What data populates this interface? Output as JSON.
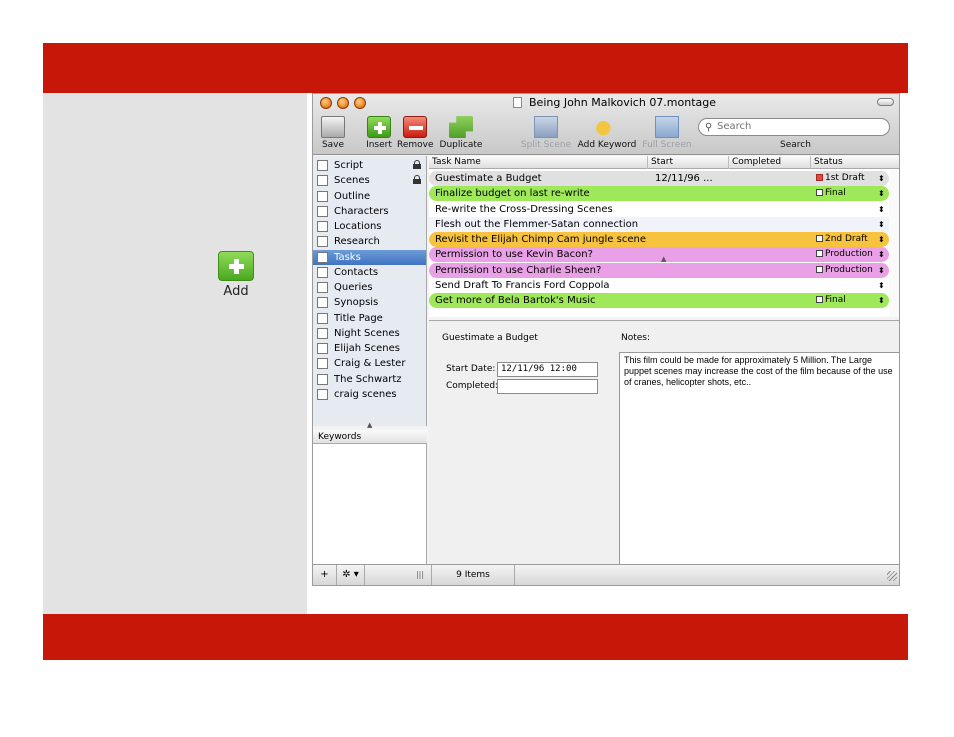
{
  "slide": {
    "add_label": "Add",
    "colors": {
      "band": "#c61708",
      "panel": "#e3e3e3"
    }
  },
  "window": {
    "title": "Being John Malkovich 07.montage",
    "toolbar": {
      "save": "Save",
      "insert": "Insert",
      "remove": "Remove",
      "duplicate": "Duplicate",
      "split_scene": "Split Scene",
      "add_keyword": "Add Keyword",
      "full_screen": "Full Screen",
      "search_label": "Search",
      "search_placeholder": "Search"
    },
    "sidebar": {
      "items": [
        {
          "label": "Script",
          "icon": "script-icon",
          "locked": true
        },
        {
          "label": "Scenes",
          "icon": "scenes-icon",
          "locked": true
        },
        {
          "label": "Outline",
          "icon": "outline-icon"
        },
        {
          "label": "Characters",
          "icon": "characters-icon"
        },
        {
          "label": "Locations",
          "icon": "locations-icon"
        },
        {
          "label": "Research",
          "icon": "research-icon"
        },
        {
          "label": "Tasks",
          "icon": "tasks-icon",
          "selected": true
        },
        {
          "label": "Contacts",
          "icon": "contacts-icon"
        },
        {
          "label": "Queries",
          "icon": "queries-icon"
        },
        {
          "label": "Synopsis",
          "icon": "synopsis-icon"
        },
        {
          "label": "Title Page",
          "icon": "title-page-icon"
        },
        {
          "label": "Night Scenes",
          "icon": "smart-folder-icon"
        },
        {
          "label": "Elijah Scenes",
          "icon": "smart-folder-icon"
        },
        {
          "label": "Craig & Lester",
          "icon": "smart-folder-icon"
        },
        {
          "label": "The Schwartz",
          "icon": "smart-folder-icon"
        },
        {
          "label": "craig scenes",
          "icon": "smart-folder-icon"
        }
      ]
    },
    "keywords_header": "Keywords",
    "bottom_bar": {
      "add": "+",
      "action": "✲ ▾",
      "item_count": "9 Items"
    },
    "table": {
      "columns": {
        "name": "Task Name",
        "start": "Start",
        "completed": "Completed",
        "status": "Status"
      },
      "rows": [
        {
          "name": "Guestimate a Budget",
          "start": "12/11/96 ...",
          "status": "1st Draft",
          "color": "#e0e0e0",
          "status_box": "red"
        },
        {
          "name": "Finalize budget on last re-write",
          "start": "",
          "status": "Final",
          "color": "#9ee85a"
        },
        {
          "name": "Re-write the Cross-Dressing Scenes",
          "start": "",
          "status": "",
          "color": ""
        },
        {
          "name": "Flesh out the Flemmer-Satan connection",
          "start": "",
          "status": "",
          "color": "#f0f4fa"
        },
        {
          "name": "Revisit the Elijah Chimp Cam jungle scene",
          "start": "",
          "status": "2nd Draft",
          "color": "#f7c23e"
        },
        {
          "name": "Permission to use Kevin Bacon?",
          "start": "",
          "status": "Production",
          "color": "#eaa0e6"
        },
        {
          "name": "Permission to use Charlie Sheen?",
          "start": "",
          "status": "Production",
          "color": "#eaa0e6"
        },
        {
          "name": "Send Draft To Francis Ford Coppola",
          "start": "",
          "status": "",
          "color": ""
        },
        {
          "name": "Get more of Bela Bartok's Music",
          "start": "",
          "status": "Final",
          "color": "#9ee85a"
        }
      ]
    },
    "detail": {
      "title": "Guestimate a Budget",
      "start_label": "Start Date:",
      "start_value": "12/11/96 12:00",
      "completed_label": "Completed:",
      "completed_value": "",
      "notes_label": "Notes:",
      "notes": "This film could be made for approximately 5 Million. The Large puppet scenes may increase the cost of the film because of the use of cranes, helicopter shots, etc.."
    }
  }
}
